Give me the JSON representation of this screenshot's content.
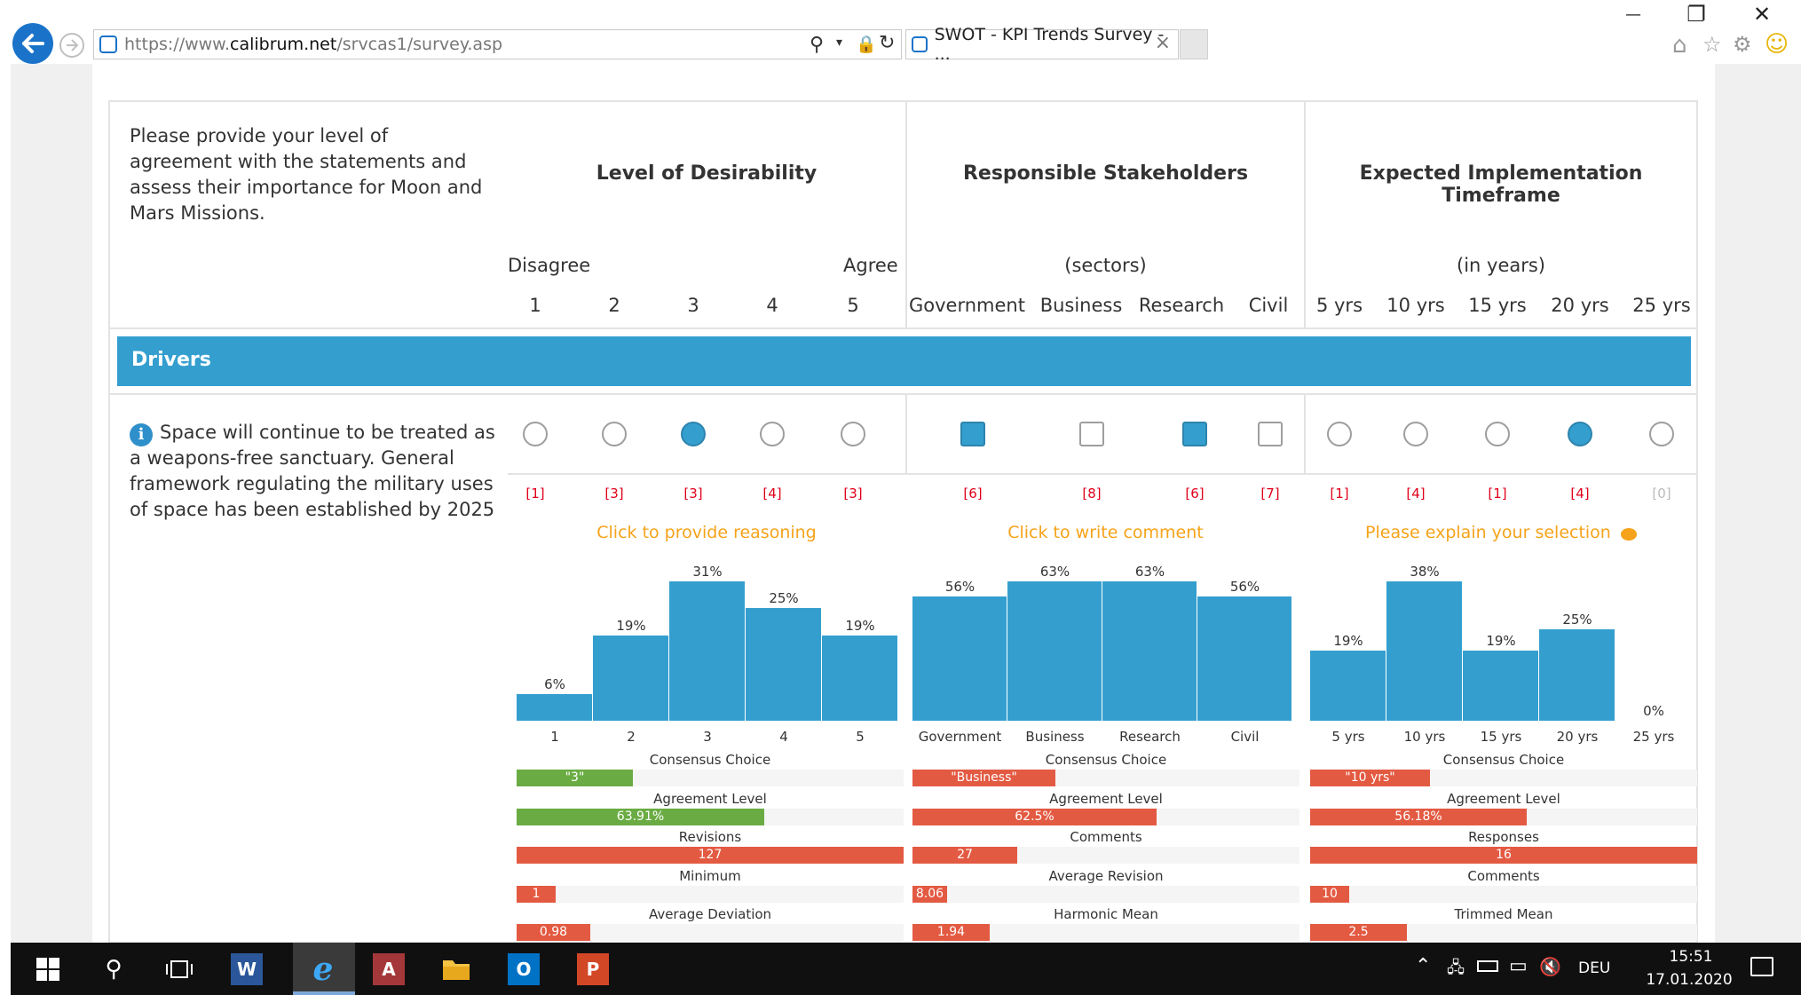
{
  "browser": {
    "url_prefix": "https://www.",
    "url_domain": "calibrum.net",
    "url_path": "/srvcas1/survey.asp",
    "tab_title": "SWOT - KPI Trends Survey - ...",
    "tab_close": "×",
    "window_controls": {
      "minimize": "—",
      "restore": "❐",
      "close": "✕"
    }
  },
  "survey": {
    "instructions": "Please provide your level of agreement with the statements and assess their importance for Moon and Mars Missions.",
    "headers": {
      "desirability": "Level of Desirability",
      "stakeholders": "Responsible Stakeholders",
      "timeframe": "Expected Implementation Timeframe"
    },
    "subheaders": {
      "disagree": "Disagree",
      "agree": "Agree",
      "sectors": "(sectors)",
      "years": "(in years)"
    },
    "scale": [
      "1",
      "2",
      "3",
      "4",
      "5"
    ],
    "sectors": [
      "Government",
      "Business",
      "Research",
      "Civil"
    ],
    "timeframes": [
      "5 yrs",
      "10 yrs",
      "15 yrs",
      "20 yrs",
      "25 yrs"
    ],
    "section_title": "Drivers",
    "statement": "Space will continue to be treated as a weapons-free sanctuary. General framework regulating the military uses of space has been established by 2025",
    "info_icon": "i",
    "counts": {
      "scale": [
        "[1]",
        "[3]",
        "[3]",
        "[4]",
        "[3]"
      ],
      "sectors": [
        "[6]",
        "[8]",
        "[6]",
        "[7]"
      ],
      "timeframes": [
        "[1]",
        "[4]",
        "[1]",
        "[4]",
        "[0]"
      ]
    },
    "links": {
      "reasoning": "Click to provide reasoning",
      "comment": "Click to write comment",
      "explain": "Please explain your selection"
    },
    "selected": {
      "scale": 2,
      "sectors": [
        0,
        2
      ],
      "timeframe": 3
    },
    "accent": "#349fcf",
    "stats": {
      "desirability": {
        "consensus_label": "Consensus Choice",
        "consensus_value": "\"3\"",
        "consensus_fill": 0.3,
        "agreement_label": "Agreement Level",
        "agreement_value": "63.91%",
        "agreement_fill": 0.64,
        "row3_label": "Revisions",
        "row3_value": "127",
        "row3_fill": 1.0,
        "row4_label": "Minimum",
        "row4_value": "1",
        "row4_fill": 0.1,
        "row5_label": "Average Deviation",
        "row5_value": "0.98",
        "row5_fill": 0.19
      },
      "stakeholders": {
        "consensus_label": "Consensus Choice",
        "consensus_value": "\"Business\"",
        "consensus_fill": 0.37,
        "agreement_label": "Agreement Level",
        "agreement_value": "62.5%",
        "agreement_fill": 0.63,
        "row3_label": "Comments",
        "row3_value": "27",
        "row3_fill": 0.27,
        "row4_label": "Average Revision",
        "row4_value": "8.06",
        "row4_fill": 0.09,
        "row5_label": "Harmonic Mean",
        "row5_value": "1.94",
        "row5_fill": 0.2
      },
      "timeframe": {
        "consensus_label": "Consensus Choice",
        "consensus_value": "\"10 yrs\"",
        "consensus_fill": 0.31,
        "agreement_label": "Agreement Level",
        "agreement_value": "56.18%",
        "agreement_fill": 0.56,
        "row3_label": "Responses",
        "row3_value": "16",
        "row3_fill": 1.0,
        "row4_label": "Comments",
        "row4_value": "10",
        "row4_fill": 0.1,
        "row5_label": "Trimmed Mean",
        "row5_value": "2.5",
        "row5_fill": 0.25
      }
    }
  },
  "chart_data": [
    {
      "type": "bar",
      "categories": [
        "1",
        "2",
        "3",
        "4",
        "5"
      ],
      "values": [
        6,
        19,
        31,
        25,
        19
      ],
      "labels": [
        "6%",
        "19%",
        "31%",
        "25%",
        "19%"
      ],
      "ylim": [
        0,
        31
      ]
    },
    {
      "type": "bar",
      "categories": [
        "Government",
        "Business",
        "Research",
        "Civil"
      ],
      "values": [
        56,
        63,
        63,
        56
      ],
      "labels": [
        "56%",
        "63%",
        "63%",
        "56%"
      ],
      "ylim": [
        0,
        63
      ]
    },
    {
      "type": "bar",
      "categories": [
        "5 yrs",
        "10 yrs",
        "15 yrs",
        "20 yrs",
        "25 yrs"
      ],
      "values": [
        19,
        38,
        19,
        25,
        0
      ],
      "labels": [
        "19%",
        "38%",
        "19%",
        "25%",
        "0%"
      ],
      "ylim": [
        0,
        38
      ]
    }
  ],
  "taskbar": {
    "lang": "DEU",
    "time": "15:51",
    "date": "17.01.2020",
    "apps": [
      "W",
      "e",
      "A",
      "O",
      "P"
    ]
  }
}
